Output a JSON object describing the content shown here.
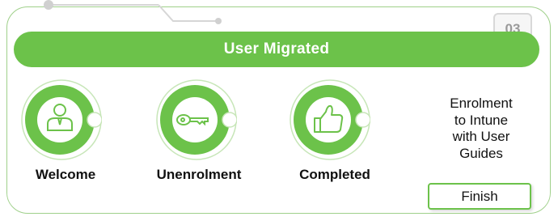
{
  "banner": {
    "title": "User Migrated"
  },
  "step": {
    "number": "03"
  },
  "stages": [
    {
      "label": "Welcome",
      "icon": "user-icon"
    },
    {
      "label": "Unenrolment",
      "icon": "key-icon"
    },
    {
      "label": "Completed",
      "icon": "thumbs-up-icon"
    }
  ],
  "info": {
    "lines": [
      "Enrolment",
      "to Intune",
      "with User",
      "Guides"
    ]
  },
  "actions": {
    "finish_label": "Finish"
  },
  "colors": {
    "accent": "#6cc24a",
    "border": "#9fd08a",
    "step_text": "#9a9a9a"
  }
}
